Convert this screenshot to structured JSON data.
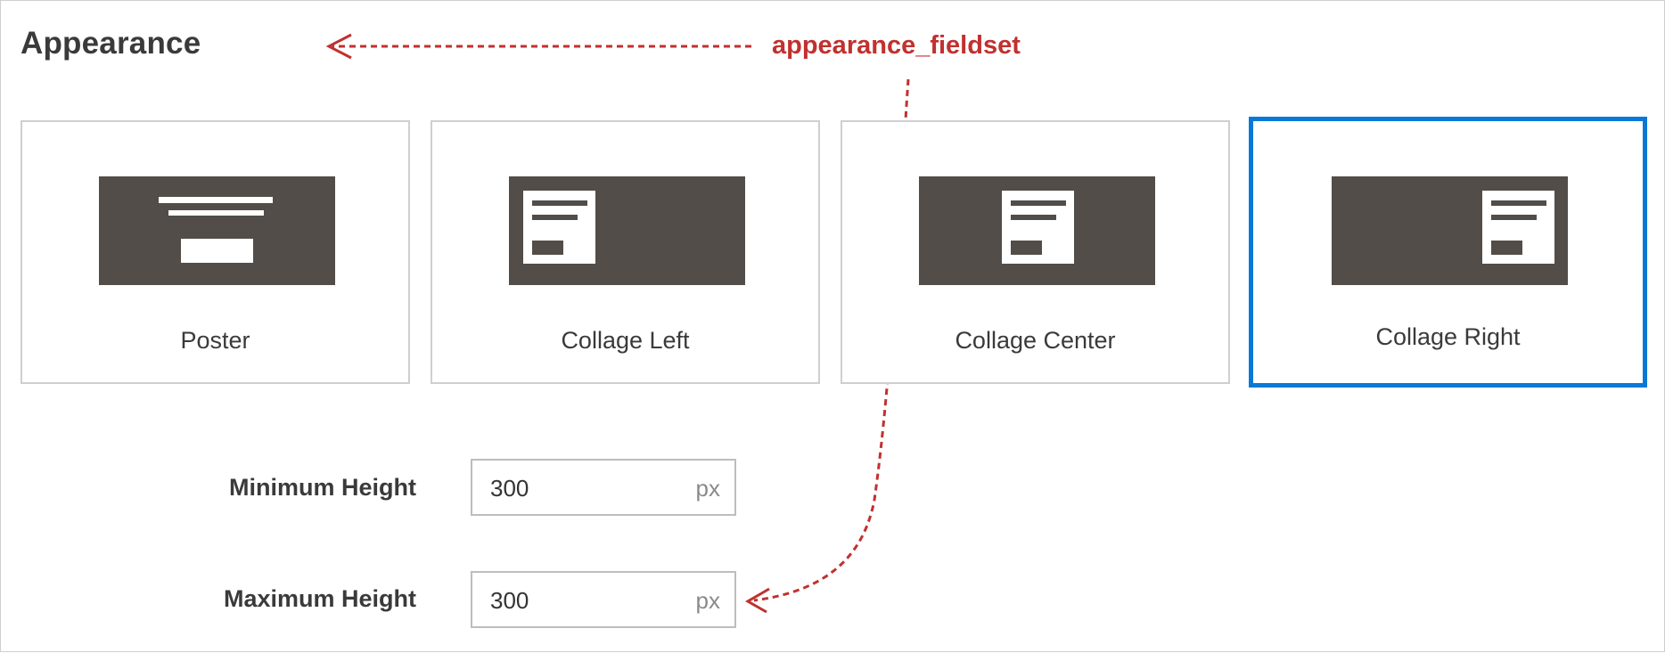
{
  "section": {
    "title": "Appearance"
  },
  "annotation": {
    "label": "appearance_fieldset",
    "color": "#c0312f"
  },
  "appearances": [
    {
      "label": "Poster",
      "selected": false
    },
    {
      "label": "Collage Left",
      "selected": false
    },
    {
      "label": "Collage Center",
      "selected": false
    },
    {
      "label": "Collage Right",
      "selected": true
    }
  ],
  "fields": {
    "min_height": {
      "label": "Minimum Height",
      "value": "300",
      "unit": "px"
    },
    "max_height": {
      "label": "Maximum Height",
      "value": "300",
      "unit": "px"
    }
  },
  "colors": {
    "selected_border": "#0a78d6",
    "thumbnail": "#524d48"
  }
}
